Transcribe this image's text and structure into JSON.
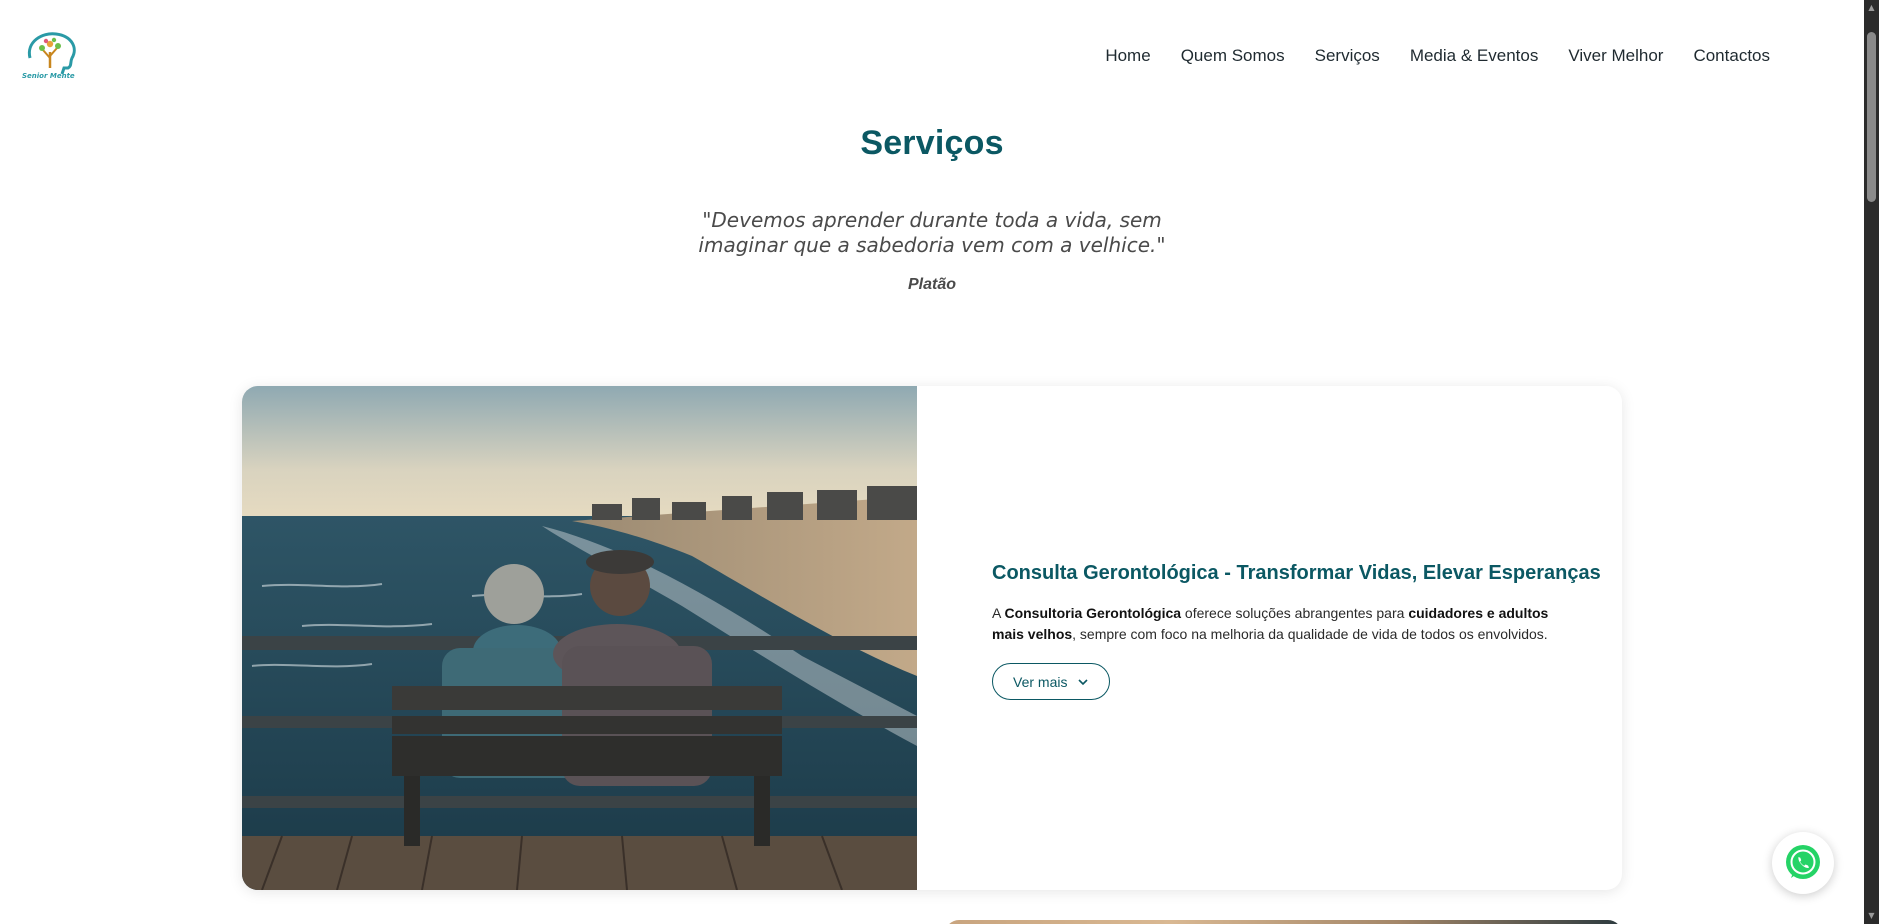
{
  "nav": {
    "items": [
      "Home",
      "Quem Somos",
      "Serviços",
      "Media & Eventos",
      "Viver Melhor",
      "Contactos"
    ]
  },
  "logo": {
    "icon": "senior-mente-logo",
    "text": "Senior Mente"
  },
  "hero": {
    "title": "Serviços",
    "quote": "\"Devemos aprender durante toda a vida, sem imaginar que a sabedoria vem com a velhice.\"",
    "author": "Platão"
  },
  "service": {
    "title": "Consulta Gerontológica - Transformar Vidas, Elevar Esperanças",
    "text_parts": {
      "a": "A ",
      "b1": "Consultoria Gerontológica",
      "c": " oferece soluções abrangentes para ",
      "b2": "cuidadores e adultos mais velhos",
      "d": ", sempre com foco na melhoria da qualidade de vida de todos os envolvidos."
    },
    "button_label": "Ver mais",
    "image_icon": "elderly-couple-on-pier-photo"
  },
  "whatsapp": {
    "icon": "whatsapp-icon"
  },
  "colors": {
    "accent": "#0b5863",
    "text": "#1f2a30"
  }
}
